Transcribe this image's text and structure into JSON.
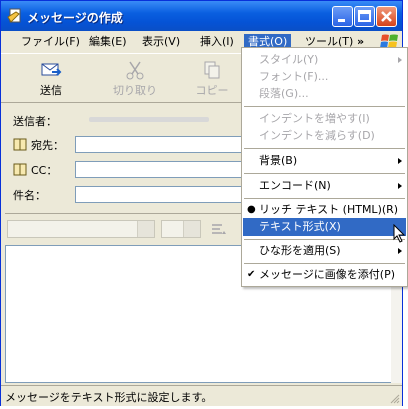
{
  "window": {
    "title": "メッセージの作成"
  },
  "menubar": {
    "items": [
      "ファイル(F)",
      "編集(E)",
      "表示(V)",
      "挿入(I)",
      "書式(O)",
      "ツール(T)"
    ],
    "more": "»"
  },
  "toolbar": {
    "send": "送信",
    "cut": "切り取り",
    "copy": "コピー"
  },
  "headers": {
    "from_label": "送信者：",
    "to_label": "宛先：",
    "cc_label": "CC：",
    "subject_label": "件名："
  },
  "format_menu": {
    "style": "スタイル(Y)",
    "font": "フォント(F)...",
    "paragraph": "段落(G)...",
    "increase_indent": "インデントを増やす(I)",
    "decrease_indent": "インデントを減らす(D)",
    "background": "背景(B)",
    "encoding": "エンコード(N)",
    "rich_text": "リッチ テキスト (HTML)(R)",
    "plain_text": "テキスト形式(X)",
    "apply_template": "ひな形を適用(S)",
    "send_pictures": "メッセージに画像を添付(P)"
  },
  "status": {
    "text": "メッセージをテキスト形式に設定します。"
  },
  "colors": {
    "titlebar": "#0a5fe0",
    "highlight": "#316ac5"
  }
}
